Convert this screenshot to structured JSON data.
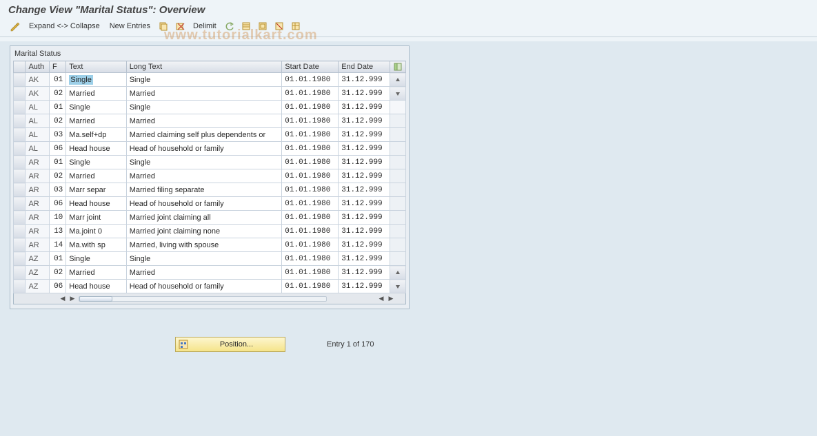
{
  "title": "Change View \"Marital Status\": Overview",
  "watermark": "www.tutorialkart.com",
  "toolbar": {
    "expand_collapse": "Expand <-> Collapse",
    "new_entries": "New Entries",
    "delimit": "Delimit"
  },
  "panel": {
    "title": "Marital Status"
  },
  "columns": {
    "auth": "Auth",
    "f": "F",
    "text": "Text",
    "long": "Long Text",
    "start": "Start Date",
    "end": "End Date"
  },
  "rows": [
    {
      "auth": "AK",
      "f": "01",
      "text": "Single",
      "long": "Single",
      "start": "01.01.1980",
      "end": "31.12.999",
      "selected": true
    },
    {
      "auth": "AK",
      "f": "02",
      "text": "Married",
      "long": "Married",
      "start": "01.01.1980",
      "end": "31.12.999"
    },
    {
      "auth": "AL",
      "f": "01",
      "text": "Single",
      "long": "Single",
      "start": "01.01.1980",
      "end": "31.12.999"
    },
    {
      "auth": "AL",
      "f": "02",
      "text": "Married",
      "long": "Married",
      "start": "01.01.1980",
      "end": "31.12.999"
    },
    {
      "auth": "AL",
      "f": "03",
      "text": "Ma.self+dp",
      "long": "Married claiming self plus dependents or",
      "start": "01.01.1980",
      "end": "31.12.999"
    },
    {
      "auth": "AL",
      "f": "06",
      "text": "Head house",
      "long": "Head of household or family",
      "start": "01.01.1980",
      "end": "31.12.999"
    },
    {
      "auth": "AR",
      "f": "01",
      "text": "Single",
      "long": "Single",
      "start": "01.01.1980",
      "end": "31.12.999"
    },
    {
      "auth": "AR",
      "f": "02",
      "text": "Married",
      "long": "Married",
      "start": "01.01.1980",
      "end": "31.12.999"
    },
    {
      "auth": "AR",
      "f": "03",
      "text": "Marr separ",
      "long": "Married filing separate",
      "start": "01.01.1980",
      "end": "31.12.999"
    },
    {
      "auth": "AR",
      "f": "06",
      "text": "Head house",
      "long": "Head of household or family",
      "start": "01.01.1980",
      "end": "31.12.999"
    },
    {
      "auth": "AR",
      "f": "10",
      "text": "Marr joint",
      "long": "Married joint claiming all",
      "start": "01.01.1980",
      "end": "31.12.999"
    },
    {
      "auth": "AR",
      "f": "13",
      "text": "Ma.joint 0",
      "long": "Married joint claiming none",
      "start": "01.01.1980",
      "end": "31.12.999"
    },
    {
      "auth": "AR",
      "f": "14",
      "text": "Ma.with sp",
      "long": "Married, living with spouse",
      "start": "01.01.1980",
      "end": "31.12.999"
    },
    {
      "auth": "AZ",
      "f": "01",
      "text": "Single",
      "long": "Single",
      "start": "01.01.1980",
      "end": "31.12.999"
    },
    {
      "auth": "AZ",
      "f": "02",
      "text": "Married",
      "long": "Married",
      "start": "01.01.1980",
      "end": "31.12.999"
    },
    {
      "auth": "AZ",
      "f": "06",
      "text": "Head house",
      "long": "Head of household or family",
      "start": "01.01.1980",
      "end": "31.12.999"
    }
  ],
  "footer": {
    "position_btn": "Position...",
    "entry_status": "Entry 1 of 170"
  }
}
